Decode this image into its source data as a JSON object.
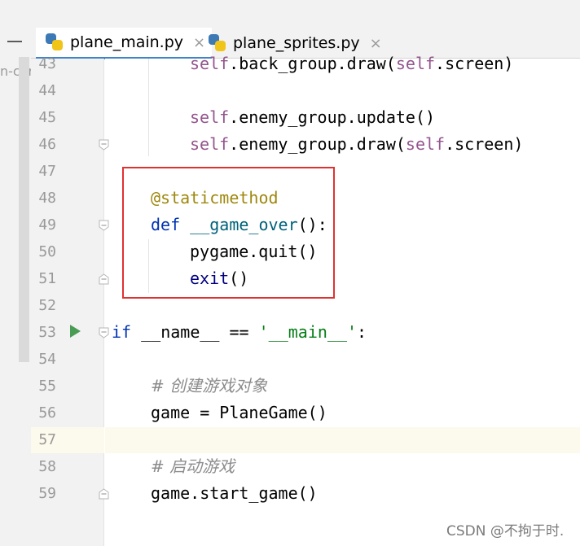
{
  "left_panel": {
    "cut_text": "n-cor"
  },
  "tabs": [
    {
      "label": "plane_main.py",
      "close": "×",
      "active": true
    },
    {
      "label": "plane_sprites.py",
      "close": "×",
      "active": false
    }
  ],
  "lines": [
    {
      "num": "43",
      "tokens": [
        {
          "t": "self",
          "c": "self"
        },
        {
          "t": ".back_group.draw(",
          "c": ""
        },
        {
          "t": "self",
          "c": "self"
        },
        {
          "t": ".screen)",
          "c": ""
        }
      ]
    },
    {
      "num": "44",
      "tokens": []
    },
    {
      "num": "45",
      "tokens": [
        {
          "t": "self",
          "c": "self"
        },
        {
          "t": ".enemy_group.update()",
          "c": ""
        }
      ]
    },
    {
      "num": "46",
      "tokens": [
        {
          "t": "self",
          "c": "self"
        },
        {
          "t": ".enemy_group.draw(",
          "c": ""
        },
        {
          "t": "self",
          "c": "self"
        },
        {
          "t": ".screen)",
          "c": ""
        }
      ]
    },
    {
      "num": "47",
      "tokens": []
    },
    {
      "num": "48",
      "tokens": [
        {
          "t": "@staticmethod",
          "c": "deco"
        }
      ]
    },
    {
      "num": "49",
      "tokens": [
        {
          "t": "def ",
          "c": "kw"
        },
        {
          "t": "__game_over",
          "c": "fn"
        },
        {
          "t": "():",
          "c": ""
        }
      ]
    },
    {
      "num": "50",
      "tokens": [
        {
          "t": "pygame.quit()",
          "c": ""
        }
      ]
    },
    {
      "num": "51",
      "tokens": [
        {
          "t": "exit",
          "c": "call"
        },
        {
          "t": "()",
          "c": ""
        }
      ]
    },
    {
      "num": "52",
      "tokens": []
    },
    {
      "num": "53",
      "tokens": [
        {
          "t": "if ",
          "c": "kw"
        },
        {
          "t": "__name__ == ",
          "c": ""
        },
        {
          "t": "'__main__'",
          "c": "str"
        },
        {
          "t": ":",
          "c": ""
        }
      ]
    },
    {
      "num": "54",
      "tokens": []
    },
    {
      "num": "55",
      "tokens": [
        {
          "t": "# 创建游戏对象",
          "c": "cmt"
        }
      ]
    },
    {
      "num": "56",
      "tokens": [
        {
          "t": "game = PlaneGame()",
          "c": ""
        }
      ]
    },
    {
      "num": "57",
      "tokens": []
    },
    {
      "num": "58",
      "tokens": [
        {
          "t": "# 启动游戏",
          "c": "cmt"
        }
      ]
    },
    {
      "num": "59",
      "tokens": [
        {
          "t": "game.start_game()",
          "c": ""
        }
      ]
    }
  ],
  "watermark": "CSDN @不拘于时."
}
